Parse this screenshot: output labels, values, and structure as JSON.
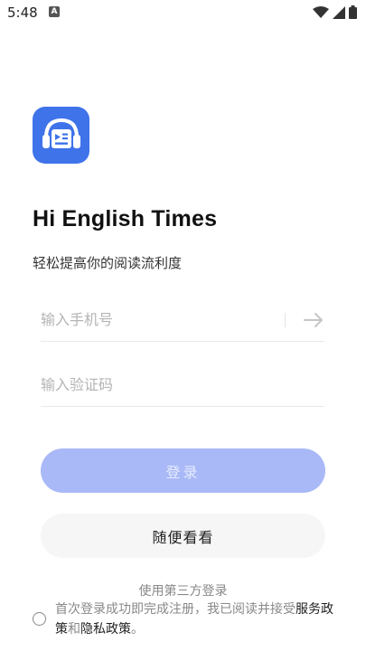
{
  "status_bar": {
    "time": "5:48",
    "notification_badge": "A",
    "icons": [
      "wifi-icon",
      "cellular-signal-icon",
      "battery-icon"
    ]
  },
  "app": {
    "logo_icon": "headphones-reader-icon",
    "title": "Hi English Times",
    "subtitle": "轻松提高你的阅读流利度",
    "brand_color": "#3f73ea"
  },
  "form": {
    "phone_placeholder": "输入手机号",
    "phone_value": "",
    "code_placeholder": "输入验证码",
    "code_value": "",
    "send_icon": "arrow-right-icon"
  },
  "buttons": {
    "login_label": "登录",
    "login_color": "#a9b9f7",
    "browse_label": "随便看看"
  },
  "footer": {
    "third_party_label": "使用第三方登录",
    "agreement_prefix": "首次登录成功即完成注册，我已阅读并接受",
    "terms_link": "服务政策",
    "and_word": "和",
    "privacy_link": "隐私政策",
    "period": "。"
  }
}
